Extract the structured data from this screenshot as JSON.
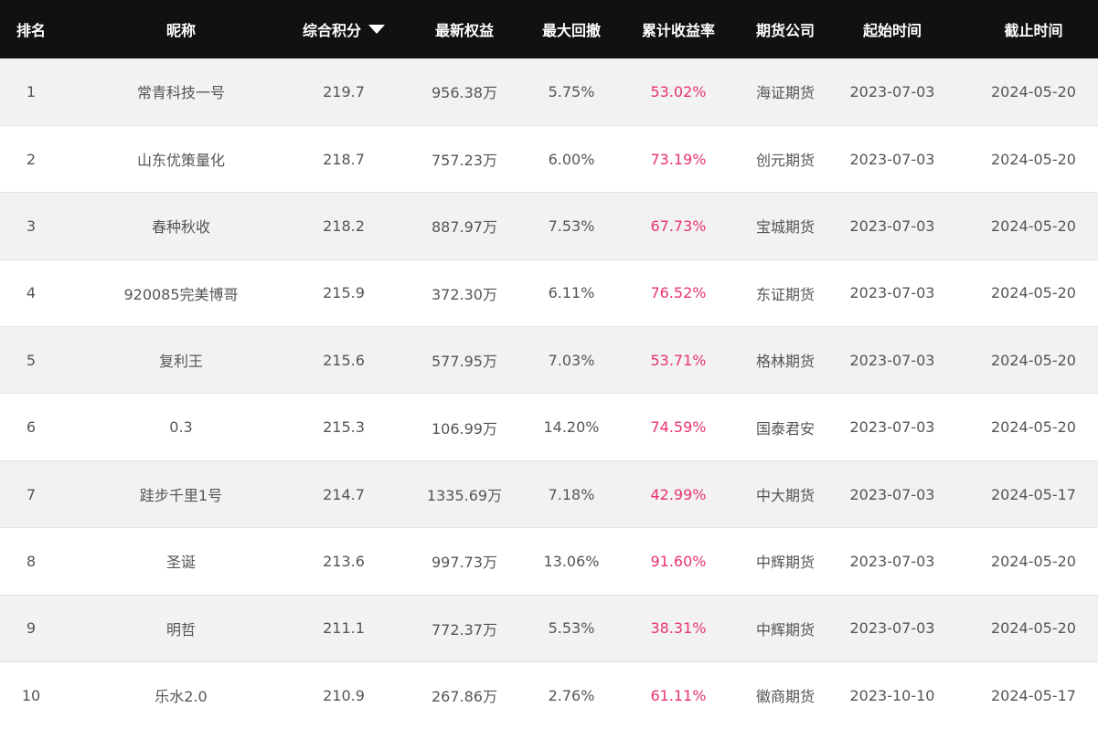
{
  "table": {
    "headers": {
      "rank": "排名",
      "nickname": "昵称",
      "score": "综合积分",
      "equity": "最新权益",
      "drawdown": "最大回撤",
      "return_rate": "累计收益率",
      "company": "期货公司",
      "start": "起始时间",
      "end": "截止时间"
    },
    "sort_indicator": "caret-down-icon",
    "rows": [
      {
        "rank": "1",
        "nickname": "常青科技一号",
        "score": "219.7",
        "equity": "956.38万",
        "drawdown": "5.75%",
        "return_rate": "53.02%",
        "company": "海证期货",
        "start": "2023-07-03",
        "end": "2024-05-20"
      },
      {
        "rank": "2",
        "nickname": "山东优策量化",
        "score": "218.7",
        "equity": "757.23万",
        "drawdown": "6.00%",
        "return_rate": "73.19%",
        "company": "创元期货",
        "start": "2023-07-03",
        "end": "2024-05-20"
      },
      {
        "rank": "3",
        "nickname": "春种秋收",
        "score": "218.2",
        "equity": "887.97万",
        "drawdown": "7.53%",
        "return_rate": "67.73%",
        "company": "宝城期货",
        "start": "2023-07-03",
        "end": "2024-05-20"
      },
      {
        "rank": "4",
        "nickname": "920085完美博哥",
        "score": "215.9",
        "equity": "372.30万",
        "drawdown": "6.11%",
        "return_rate": "76.52%",
        "company": "东证期货",
        "start": "2023-07-03",
        "end": "2024-05-20"
      },
      {
        "rank": "5",
        "nickname": "复利王",
        "score": "215.6",
        "equity": "577.95万",
        "drawdown": "7.03%",
        "return_rate": "53.71%",
        "company": "格林期货",
        "start": "2023-07-03",
        "end": "2024-05-20"
      },
      {
        "rank": "6",
        "nickname": "0.3",
        "score": "215.3",
        "equity": "106.99万",
        "drawdown": "14.20%",
        "return_rate": "74.59%",
        "company": "国泰君安",
        "start": "2023-07-03",
        "end": "2024-05-20"
      },
      {
        "rank": "7",
        "nickname": "跬步千里1号",
        "score": "214.7",
        "equity": "1335.69万",
        "drawdown": "7.18%",
        "return_rate": "42.99%",
        "company": "中大期货",
        "start": "2023-07-03",
        "end": "2024-05-17"
      },
      {
        "rank": "8",
        "nickname": "圣诞",
        "score": "213.6",
        "equity": "997.73万",
        "drawdown": "13.06%",
        "return_rate": "91.60%",
        "company": "中辉期货",
        "start": "2023-07-03",
        "end": "2024-05-20"
      },
      {
        "rank": "9",
        "nickname": "明哲",
        "score": "211.1",
        "equity": "772.37万",
        "drawdown": "5.53%",
        "return_rate": "38.31%",
        "company": "中辉期货",
        "start": "2023-07-03",
        "end": "2024-05-20"
      },
      {
        "rank": "10",
        "nickname": "乐水2.0",
        "score": "210.9",
        "equity": "267.86万",
        "drawdown": "2.76%",
        "return_rate": "61.11%",
        "company": "徽商期货",
        "start": "2023-10-10",
        "end": "2024-05-17"
      }
    ]
  },
  "colors": {
    "header_bg": "#111111",
    "header_text": "#ffffff",
    "row_odd": "#f2f2f2",
    "row_even": "#ffffff",
    "return_rate": "#e8336d",
    "body_text": "#555555"
  }
}
